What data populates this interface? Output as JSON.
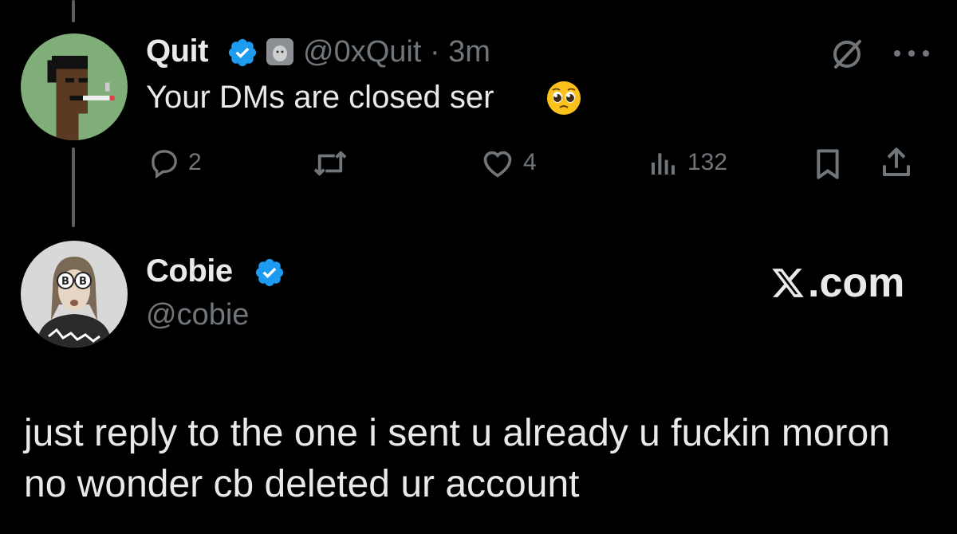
{
  "tweet": {
    "author_name": "Quit",
    "handle_time": "@0xQuit · 3m",
    "text": "Your DMs are closed ser",
    "reply_count": "2",
    "like_count": "4",
    "view_count": "132"
  },
  "reply": {
    "author_name": "Cobie",
    "handle": "@cobie",
    "body": "just reply to the one i sent u already u fuckin moron no wonder cb deleted ur account"
  },
  "watermark": ".com",
  "icons": [
    "verified-badge-icon",
    "affiliate-badge-icon",
    "pleading-face-emoji",
    "grok-icon",
    "more-icon",
    "reply-icon",
    "repost-icon",
    "like-icon",
    "views-icon",
    "bookmark-icon",
    "share-icon",
    "x-logo-icon"
  ],
  "colors": {
    "background": "#000000",
    "text": "#e7e9ea",
    "secondary": "#71767b",
    "verified": "#1d9bf0"
  }
}
